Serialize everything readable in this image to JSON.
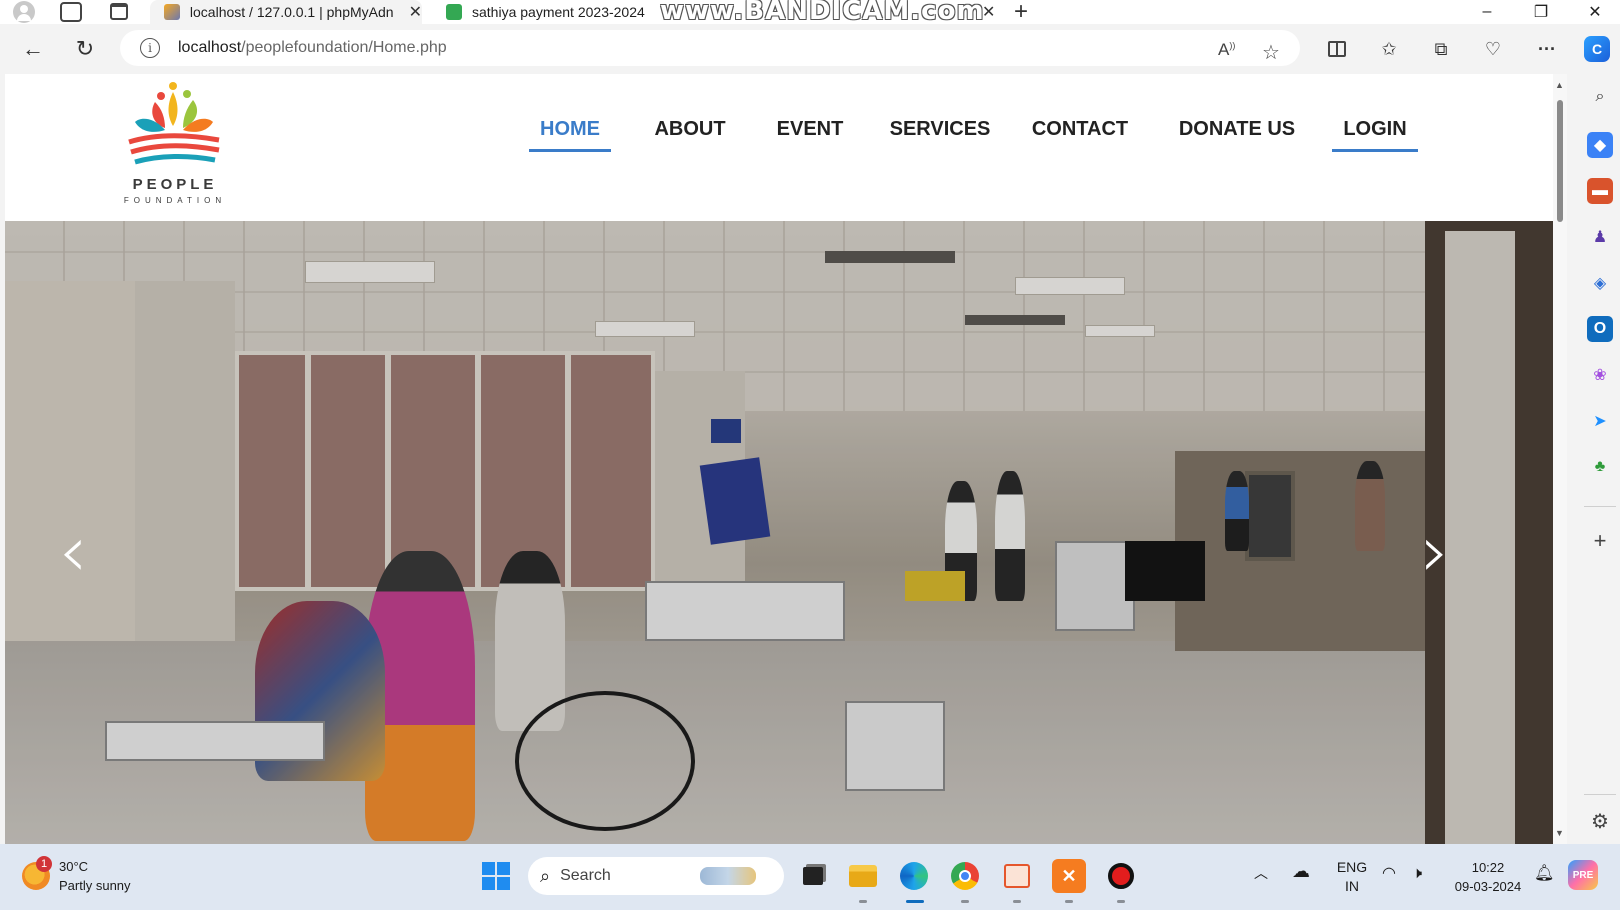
{
  "browser": {
    "tabs": [
      {
        "title": "localhost / 127.0.0.1 | phpMyAdn",
        "favicon": "phpmyadmin-icon",
        "active": true
      },
      {
        "title": "sathiya payment 2023-2024",
        "favicon": "sheets-icon",
        "active": false
      }
    ],
    "new_tab_label": "+",
    "watermark": "www.BANDICAM.com",
    "window_controls": {
      "minimize": "–",
      "restore": "❐",
      "close": "✕"
    },
    "address": {
      "host": "localhost",
      "path": "/peoplefoundation/Home.php"
    }
  },
  "site": {
    "logo": {
      "name": "PEOPLE",
      "subtitle": "FOUNDATION"
    },
    "nav": [
      {
        "label": "HOME",
        "state": "active"
      },
      {
        "label": "ABOUT",
        "state": "normal"
      },
      {
        "label": "EVENT",
        "state": "normal"
      },
      {
        "label": "SERVICES",
        "state": "normal"
      },
      {
        "label": "CONTACT",
        "state": "normal"
      },
      {
        "label": "DONATE US",
        "state": "normal"
      },
      {
        "label": "LOGIN",
        "state": "underlined"
      }
    ],
    "accent_color": "#3a7cc9",
    "carousel": {
      "prev": "‹",
      "next": "›"
    }
  },
  "taskbar": {
    "weather": {
      "temp": "30°C",
      "condition": "Partly sunny",
      "badge": "1"
    },
    "search_placeholder": "Search",
    "tray": {
      "lang_top": "ENG",
      "lang_bottom": "IN"
    },
    "clock": {
      "time": "10:22",
      "date": "09-03-2024"
    }
  }
}
